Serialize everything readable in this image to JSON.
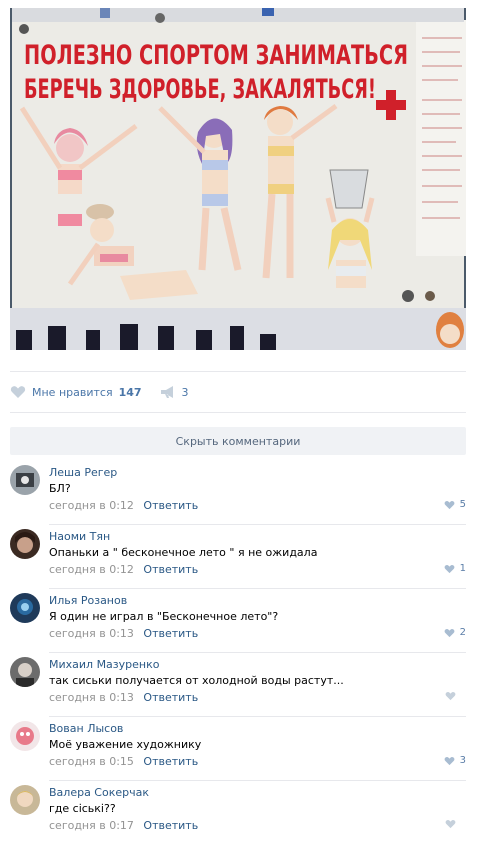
{
  "post": {
    "poster_text_line1": "ПОЛЕЗНО СПОРТОМ ЗАНИМАТЬСЯ",
    "poster_text_line2": "БЕРЕЧЬ ЗДОРОВЬЕ, ЗАКАЛЯТЬСЯ!",
    "likes_label": "Мне нравится",
    "likes_count": "147",
    "reposts_count": "3"
  },
  "comments_toggle_label": "Скрыть комментарии",
  "comments": [
    {
      "author": "Леша Регер",
      "text": "БЛ?",
      "time": "сегодня в 0:12",
      "reply": "Ответить",
      "likes": "5"
    },
    {
      "author": "Наоми Тян",
      "text": "Опаньки а \" бесконечное лето \" я не ожидала",
      "time": "сегодня в 0:12",
      "reply": "Ответить",
      "likes": "1"
    },
    {
      "author": "Илья Розанов",
      "text": "Я один не играл в \"Бесконечное лето\"?",
      "time": "сегодня в 0:13",
      "reply": "Ответить",
      "likes": "2"
    },
    {
      "author": "Михаил Мазуренко",
      "text": "так сиськи получается от холодной воды растут...",
      "time": "сегодня в 0:13",
      "reply": "Ответить",
      "likes": ""
    },
    {
      "author": "Вован Лысов",
      "text": "Моё уважение художнику",
      "time": "сегодня в 0:15",
      "reply": "Ответить",
      "likes": "3"
    },
    {
      "author": "Валера Сокерчак",
      "text": "где сіські??",
      "time": "сегодня в 0:17",
      "reply": "Ответить",
      "likes": ""
    }
  ],
  "colors": {
    "link": "#2a5885",
    "accent": "#4a76a8",
    "muted": "#939393",
    "divider": "#e7e8ec",
    "poster_red": "#d0202a"
  },
  "icons": {
    "like": "heart-icon",
    "repost": "megaphone-icon"
  }
}
